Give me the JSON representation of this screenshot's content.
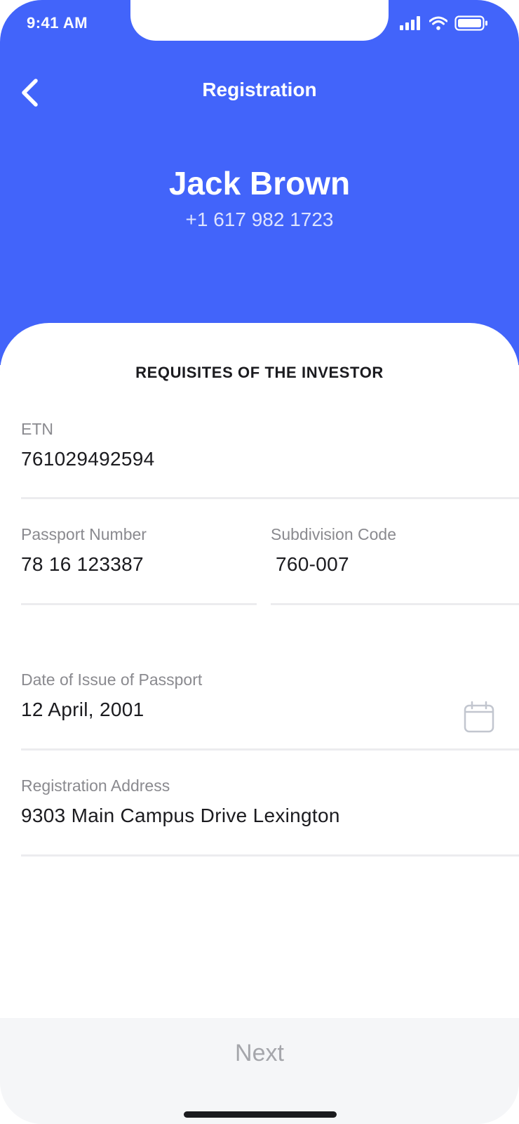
{
  "status_bar": {
    "time": "9:41 AM",
    "icons": [
      "signal-icon",
      "wifi-icon",
      "battery-icon"
    ]
  },
  "header": {
    "title": "Registration",
    "back_icon": "chevron-left-icon",
    "name": "Jack Brown",
    "phone": "+1 617 982 1723"
  },
  "form": {
    "section_title": "REQUISITES OF THE INVESTOR",
    "etn": {
      "label": "ETN",
      "value": "761029492594"
    },
    "passport_number": {
      "label": "Passport Number",
      "value": "78 16 123387"
    },
    "subdivision_code": {
      "label": "Subdivision Code",
      "value": "760-007"
    },
    "issue_date": {
      "label": "Date of Issue of Passport",
      "value": "12 April, 2001",
      "icon": "calendar-icon"
    },
    "address": {
      "label": "Registration Address",
      "value": "9303 Main Campus Drive Lexington"
    }
  },
  "footer": {
    "next_label": "Next"
  },
  "colors": {
    "accent": "#4264fa",
    "label": "#8a8a8f",
    "text": "#1b1b1f",
    "disabled": "#a5a6ab"
  }
}
